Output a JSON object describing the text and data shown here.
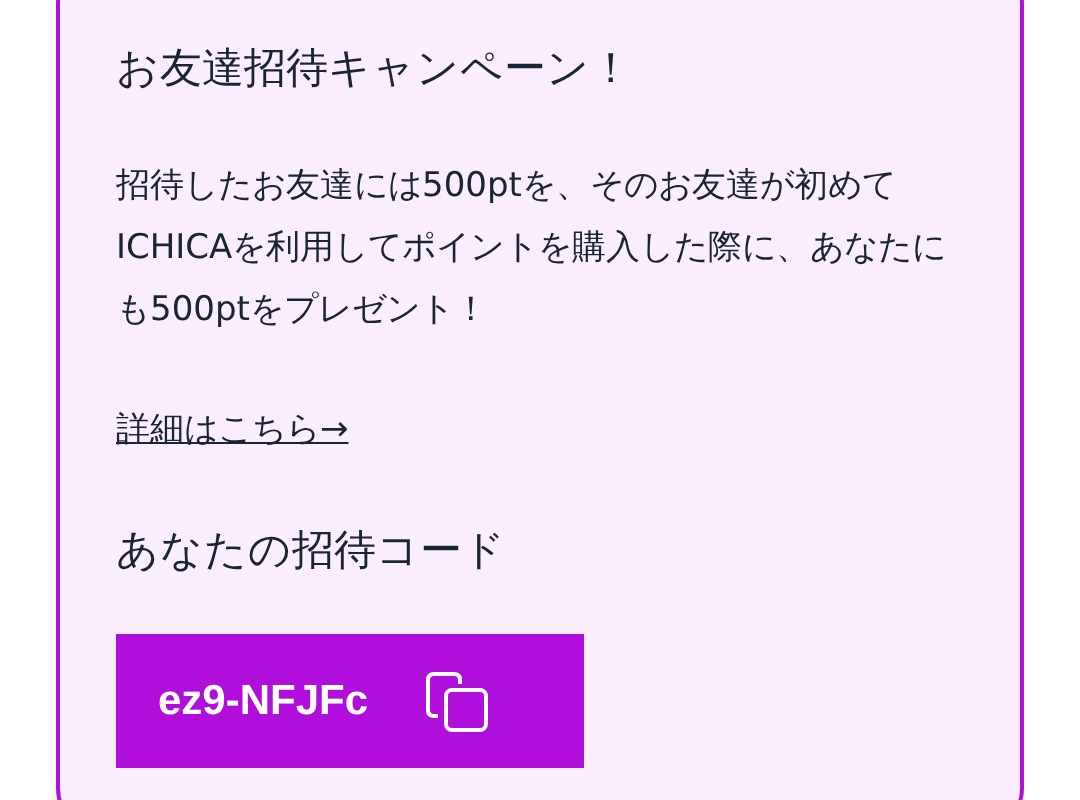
{
  "campaign": {
    "title": "お友達招待キャンペーン！",
    "description": "招待したお友達には500ptを、そのお友達が初めてICHICAを利用してポイントを購入した際に、あなたにも500ptをプレゼント！",
    "details_link": "詳細はこちら→"
  },
  "invite": {
    "heading": "あなたの招待コード",
    "code": "ez9-NFJFc"
  }
}
